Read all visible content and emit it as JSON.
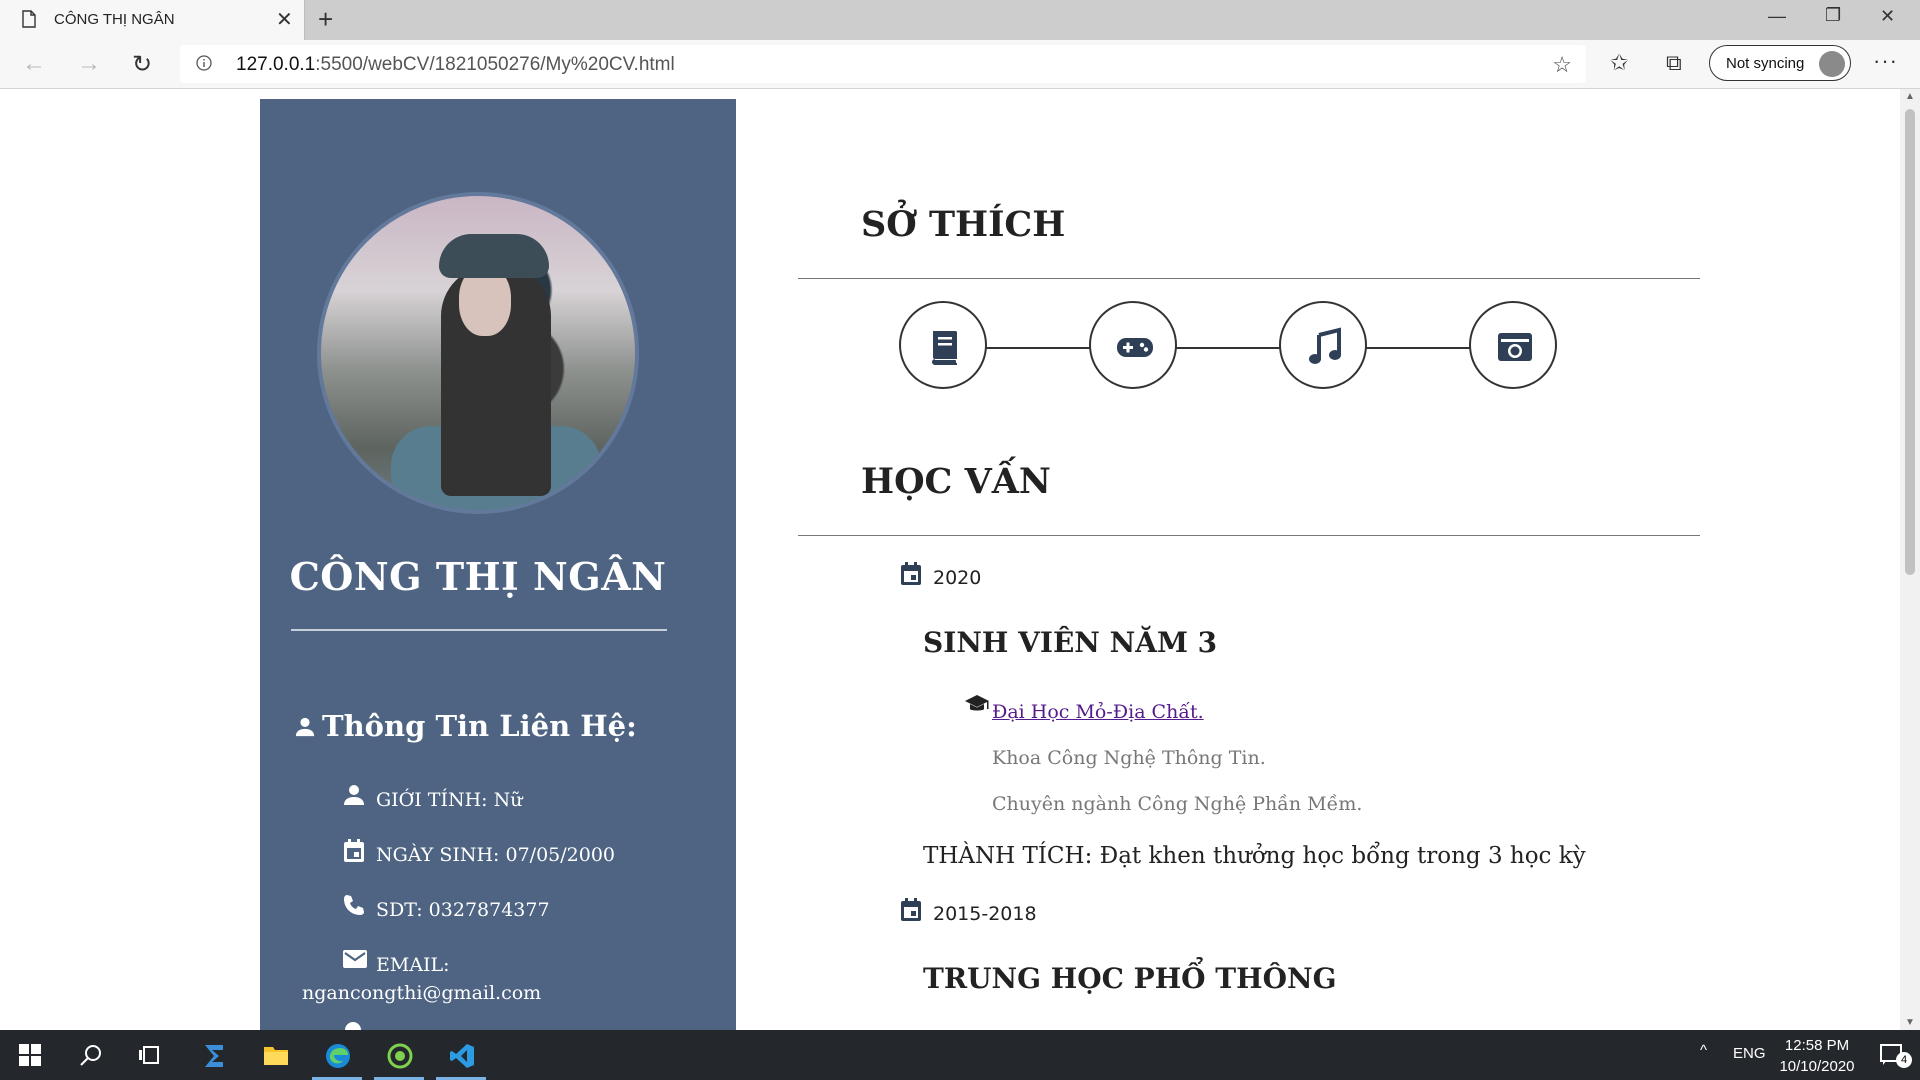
{
  "browser": {
    "tab_title": "CÔNG THỊ NGÂN",
    "url_host": "127.0.0.1",
    "url_rest": ":5500/webCV/1821050276/My%20CV.html",
    "sync_label": "Not syncing"
  },
  "sidebar": {
    "name": "CÔNG THỊ NGÂN",
    "contact_heading": "Thông Tin Liên Hệ:",
    "contact_items": [
      {
        "icon": "person-icon",
        "text": "GIỚI TÍNH: Nữ"
      },
      {
        "icon": "calendar-icon",
        "text": "NGÀY SINH: 07/05/2000"
      },
      {
        "icon": "phone-icon",
        "text": "SDT: 0327874377"
      },
      {
        "icon": "mail-icon",
        "text": "EMAIL:",
        "text2": "ngancongthi@gmail.com"
      }
    ]
  },
  "main": {
    "hobbies_title": "SỞ THÍCH",
    "hobbies": [
      "book-icon",
      "gamepad-icon",
      "music-icon",
      "camera-icon"
    ],
    "education_title": "HỌC VẤN",
    "education": [
      {
        "year": "2020",
        "title": "SINH VIÊN NĂM 3",
        "school": "Đại Học Mỏ-Địa Chất.",
        "details": [
          "Khoa Công Nghệ Thông Tin.",
          "Chuyên ngành Công Nghệ Phần Mềm."
        ],
        "achievement": "THÀNH TÍCH: Đạt khen thưởng học bổng trong 3 học kỳ"
      },
      {
        "year": "2015-2018",
        "title": "TRUNG HỌC PHỔ THÔNG"
      }
    ]
  },
  "taskbar": {
    "lang": "ENG",
    "time": "12:58 PM",
    "date": "10/10/2020",
    "notifications": "4"
  }
}
